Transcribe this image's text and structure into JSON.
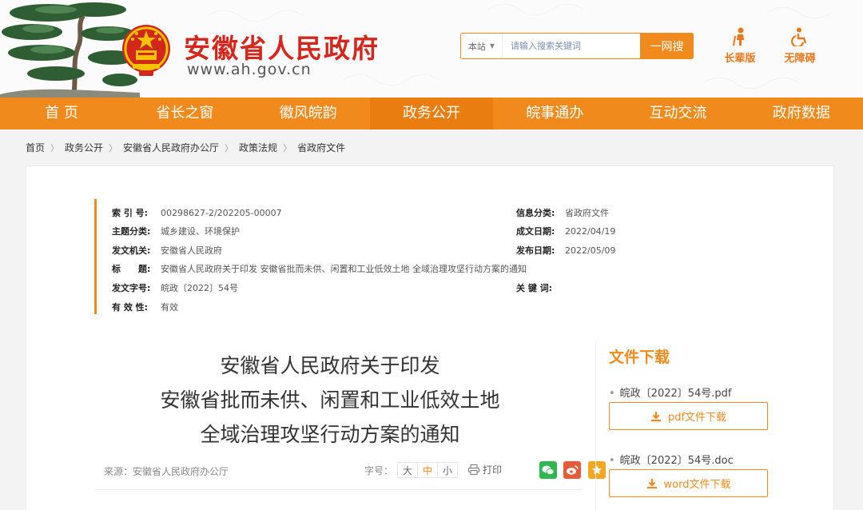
{
  "header": {
    "site_title": "安徽省人民政府",
    "site_url": "www.ah.gov.cn",
    "search": {
      "scope": "本站",
      "placeholder": "请输入搜索关键词",
      "button": "一网搜"
    },
    "quick_links": [
      {
        "label": "长辈版",
        "icon": "elder-icon"
      },
      {
        "label": "无障碍",
        "icon": "wheelchair-icon"
      }
    ]
  },
  "nav": {
    "items": [
      "首 页",
      "省长之窗",
      "徽风皖韵",
      "政务公开",
      "皖事通办",
      "互动交流",
      "政府数据"
    ],
    "active_index": 3
  },
  "breadcrumb": [
    "首页",
    "政务公开",
    "安徽省人民政府办公厅",
    "政策法规",
    "省政府文件"
  ],
  "meta": {
    "index_no": {
      "label": "索 引 号:",
      "value": "00298627-2/202205-00007"
    },
    "subject": {
      "label": "主题分类:",
      "value": "城乡建设、环境保护"
    },
    "issuer": {
      "label": "发文机关:",
      "value": "安徽省人民政府"
    },
    "title": {
      "label": "标　　题:",
      "value": "安徽省人民政府关于印发 安徽省批而未供、闲置和工业低效土地 全域治理攻坚行动方案的通知"
    },
    "doc_no": {
      "label": "发文字号:",
      "value": "皖政〔2022〕54号"
    },
    "validity": {
      "label": "有 效 性:",
      "value": "有效"
    },
    "info_class": {
      "label": "信息分类:",
      "value": "省政府文件"
    },
    "created": {
      "label": "成文日期:",
      "value": "2022/04/19"
    },
    "published": {
      "label": "发布日期:",
      "value": "2022/05/09"
    },
    "keywords": {
      "label": "关 键 词:",
      "value": ""
    }
  },
  "document": {
    "title_lines": [
      "安徽省人民政府关于印发",
      "安徽省批而未供、闲置和工业低效土地",
      "全域治理攻坚行动方案的通知"
    ],
    "source": "来源：安徽省人民政府办公厅",
    "font_size_label": "字号：",
    "font_sizes": [
      "大",
      "中",
      "小"
    ],
    "active_font_size": "中",
    "print_label": "打印"
  },
  "downloads": {
    "title": "文件下载",
    "files": [
      {
        "name": "皖政〔2022〕54号.pdf",
        "button": "pdf文件下载"
      },
      {
        "name": "皖政〔2022〕54号.doc",
        "button": "word文件下载"
      }
    ]
  },
  "colors": {
    "accent": "#f08a1c",
    "brand_red": "#d3261c",
    "wechat": "#2fb84f",
    "weibo": "#e85a38",
    "favorite": "#f5a623"
  }
}
